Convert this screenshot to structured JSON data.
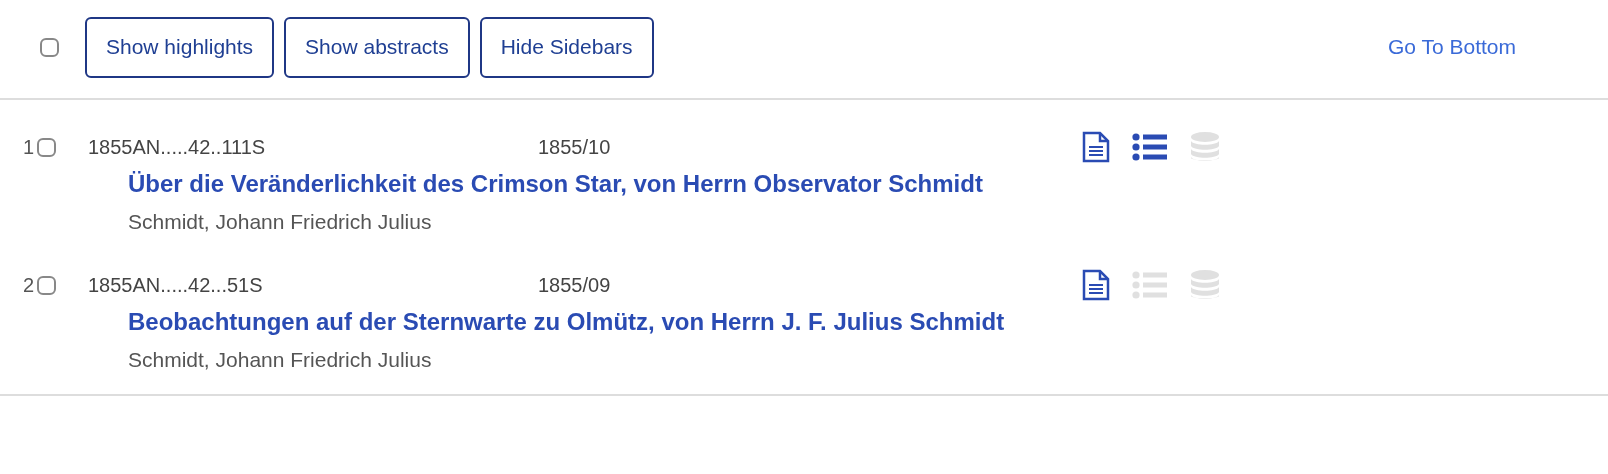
{
  "toolbar": {
    "select_all": {
      "checked": false
    },
    "buttons": [
      "Show highlights",
      "Show abstracts",
      "Hide Sidebars"
    ],
    "link": "Go To Bottom"
  },
  "results": [
    {
      "index": "1",
      "checked": false,
      "bibcode": "1855AN.....42..111S",
      "date": "1855/10",
      "title": "Über die Veränderlichkeit des Crimson Star, von Herrn Observator Schmidt",
      "author": "Schmidt, Johann Friedrich Julius",
      "resources": {
        "full_text": true,
        "references": true,
        "data": false
      }
    },
    {
      "index": "2",
      "checked": false,
      "bibcode": "1855AN.....42...51S",
      "date": "1855/09",
      "title": "Beobachtungen auf der Sternwarte zu Olmütz, von Herrn J. F. Julius Schmidt",
      "author": "Schmidt, Johann Friedrich Julius",
      "resources": {
        "full_text": true,
        "references": false,
        "data": false
      }
    }
  ]
}
